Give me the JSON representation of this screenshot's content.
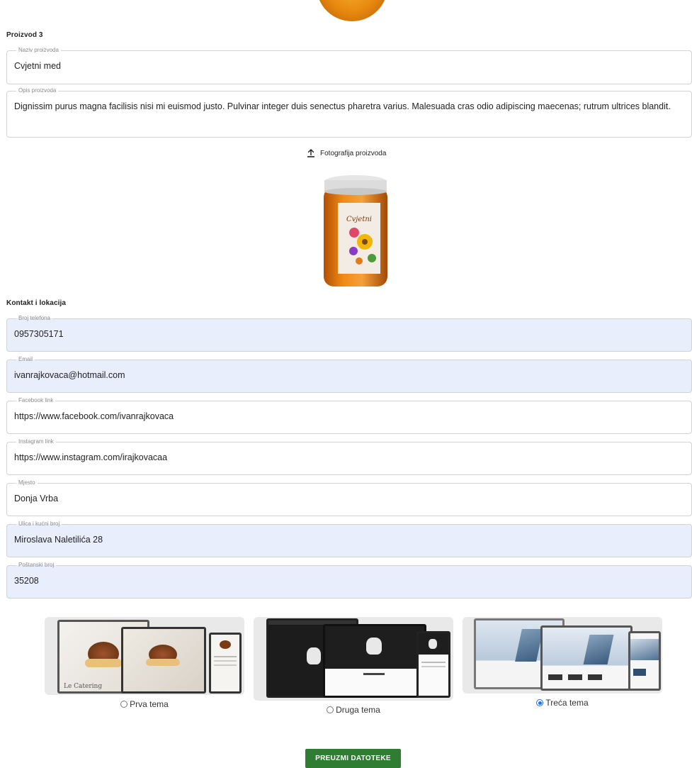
{
  "product3": {
    "section_title": "Proizvod 3",
    "name_label": "Naziv proizvoda",
    "name_value": "Cvjetni med",
    "desc_label": "Opis proizvoda",
    "desc_value": "Dignissim purus magna facilisis nisi mi euismod justo. Pulvinar integer duis senectus pharetra varius. Malesuada cras odio adipiscing maecenas; rutrum ultrices blandit.",
    "upload_label": "Fotografija proizvoda",
    "upload_icon": "upload-icon",
    "jar_label": "Cvjetni med"
  },
  "contact": {
    "section_title": "Kontakt i lokacija",
    "fields": [
      {
        "label": "Broj telefona",
        "value": "0957305171"
      },
      {
        "label": "Email",
        "value": "ivanrajkovaca@hotmail.com"
      },
      {
        "label": "Facebook link",
        "value": "https://www.facebook.com/ivanrajkovaca"
      },
      {
        "label": "Instagram link",
        "value": "https://www.instagram.com/irajkovacaa"
      },
      {
        "label": "Mjesto",
        "value": "Donja Vrba"
      },
      {
        "label": "Ulica i kućni broj",
        "value": "Miroslava Naletilića 28"
      },
      {
        "label": "Poštanski broj",
        "value": "35208"
      }
    ]
  },
  "themes": [
    {
      "label": "Prva tema",
      "selected": false
    },
    {
      "label": "Druga tema",
      "selected": false
    },
    {
      "label": "Treća tema",
      "selected": true
    }
  ],
  "download_label": "PREUZMI DATOTEKE",
  "colors": {
    "autofill_bg": "#e8eefc",
    "button_bg": "#2e7d32",
    "radio_accent": "#1a73e8",
    "honey": "#e8890f"
  }
}
